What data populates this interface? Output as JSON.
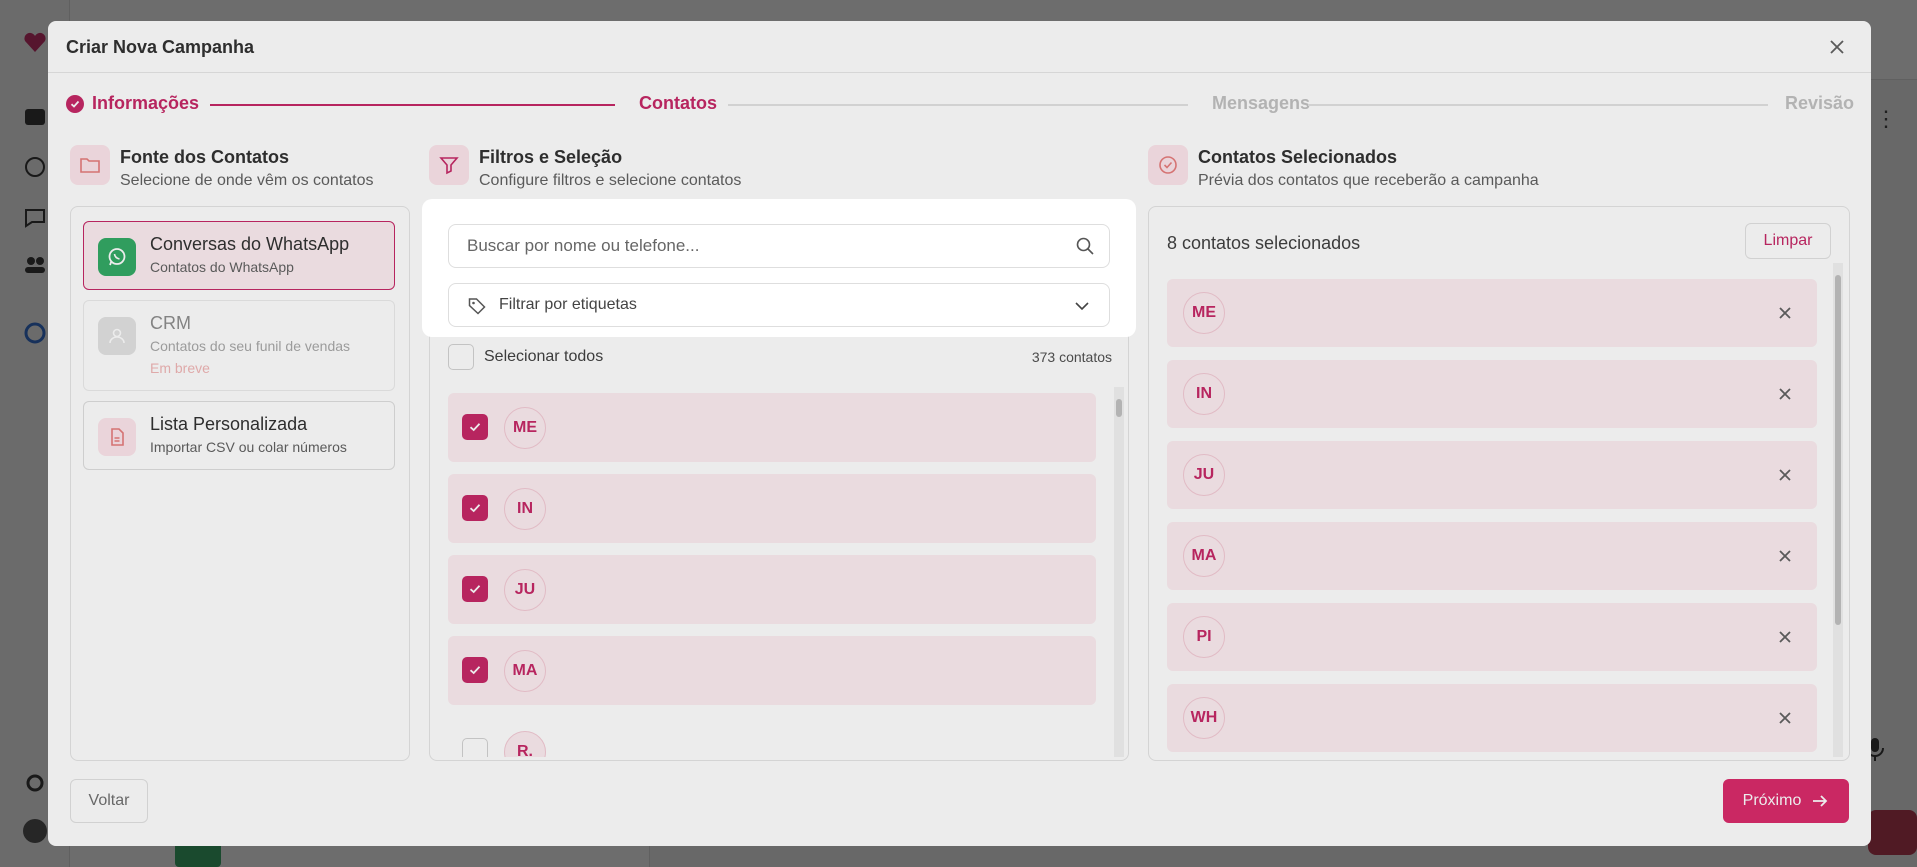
{
  "modal": {
    "title": "Criar Nova Campanha"
  },
  "stepper": {
    "steps": [
      "Informações",
      "Contatos",
      "Mensagens",
      "Revisão"
    ]
  },
  "columns": {
    "source": {
      "title": "Fonte dos Contatos",
      "subtitle": "Selecione de onde vêm os contatos",
      "cards": [
        {
          "title": "Conversas do WhatsApp",
          "subtitle": "Contatos do WhatsApp",
          "icon": "whatsapp-icon"
        },
        {
          "title": "CRM",
          "subtitle": "Contatos do seu funil de vendas",
          "badge": "Em breve",
          "icon": "crm-icon"
        },
        {
          "title": "Lista Personalizada",
          "subtitle": "Importar CSV ou colar números",
          "icon": "file-icon"
        }
      ]
    },
    "filters": {
      "title": "Filtros e Seleção",
      "subtitle": "Configure filtros e selecione contatos",
      "search_placeholder": "Buscar por nome ou telefone...",
      "tag_filter_label": "Filtrar por etiquetas",
      "select_all_label": "Selecionar todos",
      "total_label": "373 contatos",
      "contacts": [
        {
          "initials": "ME",
          "checked": true
        },
        {
          "initials": "IN",
          "checked": true
        },
        {
          "initials": "JU",
          "checked": true
        },
        {
          "initials": "MA",
          "checked": true
        },
        {
          "initials": "R.",
          "checked": false
        }
      ]
    },
    "selected": {
      "title": "Contatos Selecionados",
      "subtitle": "Prévia dos contatos que receberão a campanha",
      "count_label": "8 contatos selecionados",
      "clear_label": "Limpar",
      "contacts": [
        "ME",
        "IN",
        "JU",
        "MA",
        "PI",
        "WH"
      ]
    }
  },
  "footer": {
    "back_label": "Voltar",
    "next_label": "Próximo"
  },
  "colors": {
    "accent": "#c2185b",
    "accent_light": "#fdecf0",
    "whatsapp": "#25a35a",
    "primary_button": "#d81b60"
  }
}
